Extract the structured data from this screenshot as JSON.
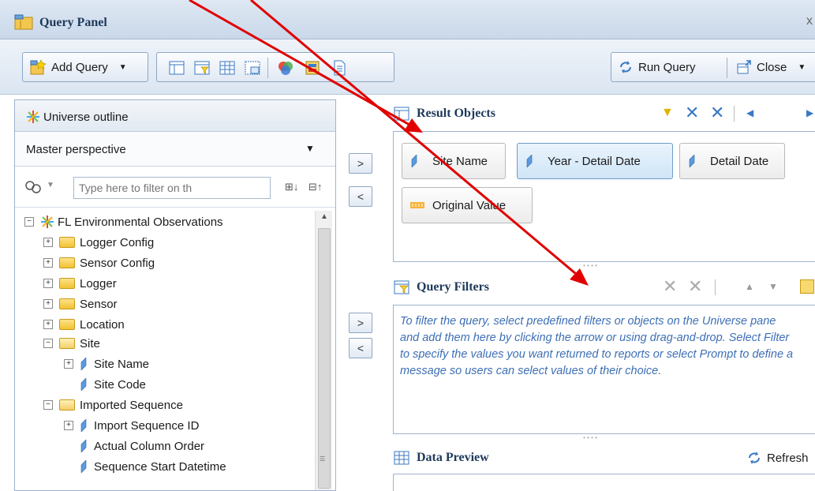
{
  "window": {
    "title": "Query Panel",
    "close_glyph": "x"
  },
  "toolbar": {
    "add_query_label": "Add Query",
    "run_query_label": "Run Query",
    "close_label": "Close",
    "icons": [
      "layout-icon",
      "filter-pane-icon",
      "data-preview-icon",
      "combined-query-icon",
      "source-icon",
      "sql-icon",
      "properties-icon"
    ]
  },
  "universe_outline": {
    "title": "Universe outline",
    "perspective": "Master perspective",
    "filter_placeholder": "Type here to filter on th",
    "tree": [
      {
        "label": "FL Environmental Observations",
        "kind": "universe",
        "expander": "minus",
        "level": 0
      },
      {
        "label": "Logger Config",
        "kind": "folder",
        "expander": "plus",
        "level": 1
      },
      {
        "label": "Sensor Config",
        "kind": "folder",
        "expander": "plus",
        "level": 1
      },
      {
        "label": "Logger",
        "kind": "folder",
        "expander": "plus",
        "level": 1
      },
      {
        "label": "Sensor",
        "kind": "folder",
        "expander": "plus",
        "level": 1
      },
      {
        "label": "Location",
        "kind": "folder",
        "expander": "plus",
        "level": 1
      },
      {
        "label": "Site",
        "kind": "folder-open",
        "expander": "minus",
        "level": 1
      },
      {
        "label": "Site Name",
        "kind": "dimension",
        "expander": "plus",
        "level": 2
      },
      {
        "label": "Site Code",
        "kind": "dimension",
        "expander": "",
        "level": 2
      },
      {
        "label": "Imported Sequence",
        "kind": "folder-open",
        "expander": "minus",
        "level": 1
      },
      {
        "label": "Import Sequence ID",
        "kind": "dimension",
        "expander": "plus",
        "level": 2
      },
      {
        "label": "Actual Column Order",
        "kind": "dimension",
        "expander": "",
        "level": 2
      },
      {
        "label": "Sequence Start Datetime",
        "kind": "dimension",
        "expander": "",
        "level": 2
      }
    ]
  },
  "move_buttons": {
    "add": ">",
    "remove": "<"
  },
  "result_objects": {
    "title": "Result Objects",
    "items": [
      {
        "label": "Site Name",
        "kind": "dimension",
        "selected": false
      },
      {
        "label": "Year - Detail Date",
        "kind": "dimension",
        "selected": true
      },
      {
        "label": "Detail Date",
        "kind": "dimension",
        "selected": false
      },
      {
        "label": "Original Value",
        "kind": "measure",
        "selected": false
      }
    ]
  },
  "query_filters": {
    "title": "Query Filters",
    "message": "To filter the query, select predefined filters or objects on the Universe pane and add them here by clicking the arrow or using drag-and-drop. Select Filter to specify the values you want returned to reports or select Prompt to define a message so users can select values of their choice."
  },
  "data_preview": {
    "title": "Data Preview",
    "refresh_label": "Refresh"
  },
  "colors": {
    "accent": "#1e395b",
    "annotation_arrow": "#e00000",
    "filter_hint": "#3d6fb5"
  }
}
